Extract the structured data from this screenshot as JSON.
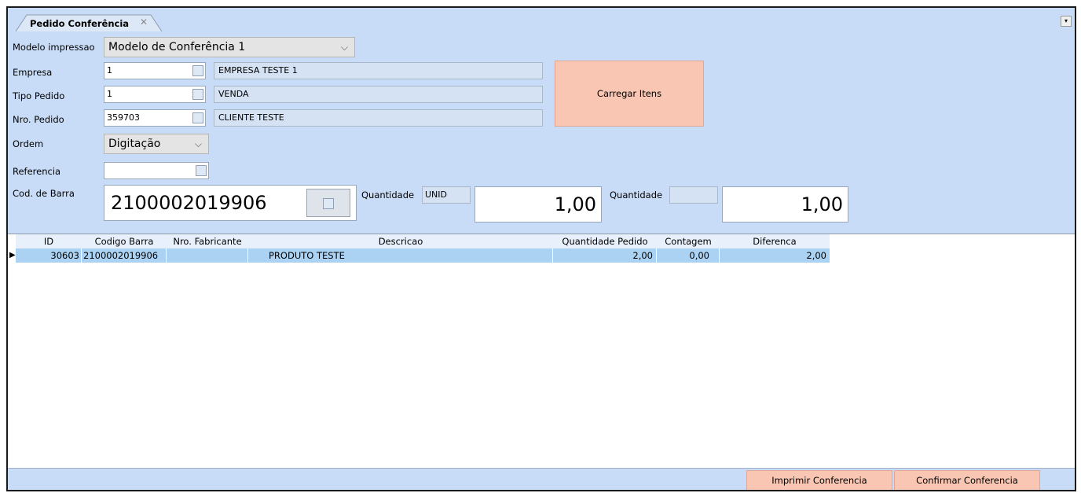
{
  "tab": {
    "title": "Pedido Conferência",
    "close": "✕"
  },
  "window_menu": "▾",
  "form": {
    "modelo": {
      "label": "Modelo impressao",
      "value": "Modelo de Conferência 1"
    },
    "empresa": {
      "label": "Empresa",
      "code": "1",
      "name": "EMPRESA TESTE 1"
    },
    "tipo": {
      "label": "Tipo Pedido",
      "code": "1",
      "name": "VENDA"
    },
    "nro": {
      "label": "Nro. Pedido",
      "code": "359703",
      "name": "CLIENTE TESTE"
    },
    "ordem": {
      "label": "Ordem",
      "value": "Digitação"
    },
    "referencia": {
      "label": "Referencia",
      "value": ""
    },
    "barcode": {
      "label": "Cod. de Barra",
      "value": "2100002019906"
    },
    "qty1": {
      "label": "Quantidade",
      "unit": "UNID",
      "value": "1,00"
    },
    "qty2": {
      "label": "Quantidade",
      "unit": "",
      "value": "1,00"
    },
    "load_button": "Carregar Itens"
  },
  "grid": {
    "columns": [
      "ID",
      "Codigo Barra",
      "Nro. Fabricante",
      "Descricao",
      "Quantidade Pedido",
      "Contagem",
      "Diferenca"
    ],
    "rows": [
      {
        "id": "30603",
        "codigo": "2100002019906",
        "fabricante": "",
        "descricao": "PRODUTO TESTE",
        "qtd": "2,00",
        "contagem": "0,00",
        "diferenca": "2,00"
      }
    ]
  },
  "footer": {
    "print_button": "Imprimir Conferencia",
    "confirm_button": "Confirmar Conferencia"
  },
  "colors": {
    "panel": "#c9dcf7",
    "selected_row": "#abd2f2",
    "action_button": "#f9c6b3"
  }
}
